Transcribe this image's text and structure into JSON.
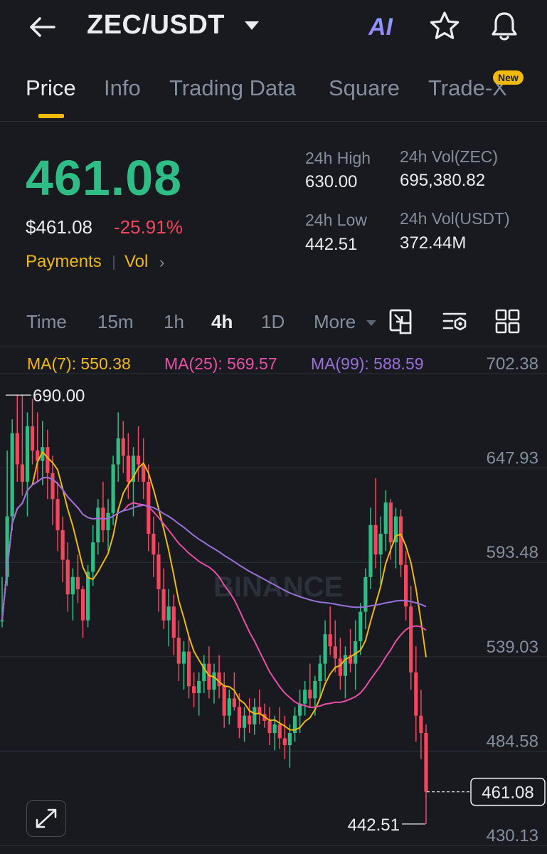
{
  "header": {
    "pair": "ZEC/USDT",
    "back_icon": "arrow-left-icon",
    "caret_icon": "caret-down-icon",
    "ai_label": "AI",
    "star_icon": "star-icon",
    "bell_icon": "bell-icon"
  },
  "tabs": [
    {
      "label": "Price",
      "active": true
    },
    {
      "label": "Info"
    },
    {
      "label": "Trading Data"
    },
    {
      "label": "Square"
    },
    {
      "label": "Trade-X",
      "badge": "New"
    }
  ],
  "price": {
    "last": "461.08",
    "usd": "$461.08",
    "change": "-25.91%",
    "tags": [
      "Payments",
      "Vol"
    ],
    "stats": {
      "high_label": "24h High",
      "high": "630.00",
      "low_label": "24h Low",
      "low": "442.51",
      "vol_base_label": "24h Vol(ZEC)",
      "vol_base": "695,380.82",
      "vol_quote_label": "24h Vol(USDT)",
      "vol_quote": "372.44M"
    }
  },
  "timeframes": {
    "items": [
      "Time",
      "15m",
      "1h",
      "4h",
      "1D",
      "More"
    ],
    "active": "4h",
    "tools": [
      "chart-type-icon",
      "indicator-settings-icon",
      "grid-layout-icon"
    ]
  },
  "ma_legend": {
    "ma7": "MA(7): 550.38",
    "ma25": "MA(25): 569.57",
    "ma99": "MA(99): 588.59"
  },
  "chart_data": {
    "type": "candlestick",
    "watermark": "BINANCE",
    "y_ticks": [
      "702.38",
      "647.93",
      "593.48",
      "539.03",
      "484.58",
      "430.13"
    ],
    "ylim": [
      430.13,
      702.38
    ],
    "high_marker": "690.00",
    "low_marker": "442.51",
    "current_price": "461.08",
    "colors": {
      "up": "#2ebd85",
      "down": "#f6465d",
      "ma7": "#f0b90b",
      "ma25": "#e84fa5",
      "ma99": "#9a6fd8"
    },
    "candles": [
      [
        560,
        585,
        556,
        560
      ],
      [
        585,
        658,
        580,
        620
      ],
      [
        620,
        676,
        612,
        668
      ],
      [
        668,
        690,
        640,
        650
      ],
      [
        650,
        690,
        632,
        640
      ],
      [
        640,
        680,
        620,
        672
      ],
      [
        672,
        688,
        650,
        658
      ],
      [
        658,
        680,
        640,
        652
      ],
      [
        652,
        675,
        638,
        660
      ],
      [
        660,
        670,
        630,
        645
      ],
      [
        645,
        655,
        615,
        630
      ],
      [
        630,
        640,
        600,
        612
      ],
      [
        612,
        620,
        582,
        595
      ],
      [
        595,
        605,
        565,
        575
      ],
      [
        575,
        590,
        560,
        585
      ],
      [
        585,
        598,
        570,
        578
      ],
      [
        578,
        580,
        550,
        560
      ],
      [
        560,
        592,
        556,
        588
      ],
      [
        588,
        615,
        580,
        605
      ],
      [
        605,
        630,
        598,
        625
      ],
      [
        625,
        640,
        605,
        612
      ],
      [
        612,
        630,
        600,
        622
      ],
      [
        622,
        655,
        615,
        650
      ],
      [
        650,
        680,
        640,
        665
      ],
      [
        665,
        675,
        645,
        655
      ],
      [
        655,
        668,
        630,
        640
      ],
      [
        640,
        660,
        620,
        655
      ],
      [
        655,
        672,
        640,
        650
      ],
      [
        650,
        665,
        630,
        640
      ],
      [
        640,
        650,
        600,
        610
      ],
      [
        610,
        620,
        585,
        598
      ],
      [
        598,
        605,
        565,
        578
      ],
      [
        578,
        590,
        555,
        560
      ],
      [
        560,
        578,
        545,
        568
      ],
      [
        568,
        575,
        540,
        550
      ],
      [
        550,
        560,
        525,
        535
      ],
      [
        535,
        548,
        520,
        542
      ],
      [
        542,
        550,
        515,
        522
      ],
      [
        522,
        530,
        510,
        518
      ],
      [
        518,
        530,
        505,
        525
      ],
      [
        525,
        540,
        518,
        535
      ],
      [
        535,
        545,
        515,
        520
      ],
      [
        520,
        535,
        512,
        530
      ],
      [
        530,
        540,
        515,
        522
      ],
      [
        522,
        530,
        498,
        505
      ],
      [
        505,
        520,
        500,
        515
      ],
      [
        515,
        530,
        508,
        510
      ],
      [
        510,
        518,
        492,
        498
      ],
      [
        498,
        510,
        490,
        505
      ],
      [
        505,
        515,
        495,
        500
      ],
      [
        500,
        515,
        494,
        510
      ],
      [
        510,
        520,
        500,
        506
      ],
      [
        506,
        512,
        498,
        502
      ],
      [
        502,
        510,
        488,
        495
      ],
      [
        495,
        505,
        485,
        500
      ],
      [
        500,
        510,
        486,
        492
      ],
      [
        492,
        505,
        480,
        488
      ],
      [
        488,
        500,
        475,
        495
      ],
      [
        495,
        510,
        490,
        505
      ],
      [
        505,
        520,
        495,
        512
      ],
      [
        512,
        525,
        505,
        520
      ],
      [
        520,
        535,
        510,
        515
      ],
      [
        515,
        528,
        505,
        525
      ],
      [
        525,
        540,
        515,
        535
      ],
      [
        535,
        560,
        525,
        552
      ],
      [
        552,
        568,
        540,
        545
      ],
      [
        545,
        560,
        530,
        538
      ],
      [
        538,
        550,
        520,
        528
      ],
      [
        528,
        545,
        515,
        540
      ],
      [
        540,
        555,
        530,
        535
      ],
      [
        535,
        560,
        520,
        548
      ],
      [
        548,
        570,
        540,
        565
      ],
      [
        565,
        590,
        555,
        585
      ],
      [
        585,
        625,
        578,
        615
      ],
      [
        615,
        642,
        590,
        598
      ],
      [
        598,
        620,
        580,
        610
      ],
      [
        610,
        635,
        600,
        628
      ],
      [
        628,
        630,
        595,
        605
      ],
      [
        605,
        625,
        590,
        620
      ],
      [
        620,
        624,
        585,
        592
      ],
      [
        592,
        600,
        560,
        568
      ],
      [
        568,
        580,
        520,
        530
      ],
      [
        530,
        545,
        490,
        505
      ],
      [
        505,
        520,
        480,
        495
      ],
      [
        495,
        500,
        442.51,
        461.08
      ]
    ]
  }
}
